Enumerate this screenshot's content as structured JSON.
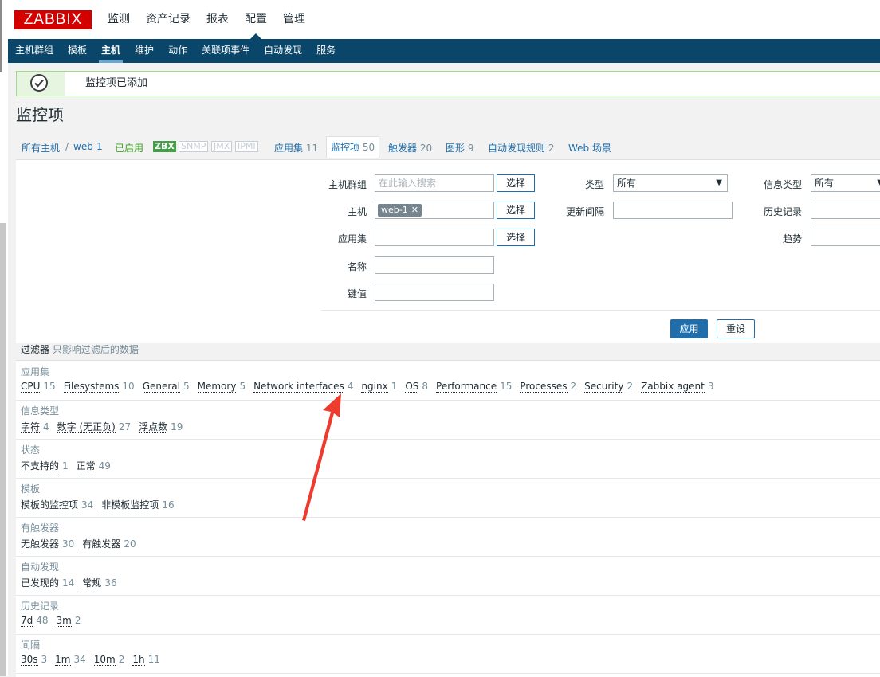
{
  "logo": "ZABBIX",
  "main_menu": [
    "监测",
    "资产记录",
    "报表",
    "配置",
    "管理"
  ],
  "sub_menu": [
    "主机群组",
    "模板",
    "主机",
    "维护",
    "动作",
    "关联项事件",
    "自动发现",
    "服务"
  ],
  "message": "监控项已添加",
  "page_title": "监控项",
  "nav": {
    "all_hosts": "所有主机",
    "sep": "/",
    "host": "web-1",
    "enabled": "已启用",
    "zbx": "ZBX",
    "snmp": "SNMP",
    "jmx": "JMX",
    "ipmi": "IPMI",
    "apps": "应用集",
    "apps_count": "11",
    "items": "监控项",
    "items_count": "50",
    "triggers": "触发器",
    "triggers_count": "20",
    "graphs": "图形",
    "graphs_count": "9",
    "discovery": "自动发现规则",
    "discovery_count": "2",
    "web": "Web 场景"
  },
  "filter": {
    "hostgroup_label": "主机群组",
    "hostgroup_placeholder": "在此输入搜索",
    "host_label": "主机",
    "host_chip": "web-1",
    "app_label": "应用集",
    "name_label": "名称",
    "key_label": "键值",
    "select_btn": "选择",
    "type_label": "类型",
    "type_value": "所有",
    "interval_label": "更新间隔",
    "infotype_label": "信息类型",
    "infotype_value": "所有",
    "history_label": "历史记录",
    "trends_label": "趋势",
    "apply": "应用",
    "reset": "重设"
  },
  "filter_line": {
    "title": "过滤器",
    "hint": "只影响过滤后的数据"
  },
  "subfilters": [
    {
      "title": "应用集",
      "items": [
        {
          "label": "CPU",
          "count": "15"
        },
        {
          "label": "Filesystems",
          "count": "10"
        },
        {
          "label": "General",
          "count": "5"
        },
        {
          "label": "Memory",
          "count": "5"
        },
        {
          "label": "Network interfaces",
          "count": "4"
        },
        {
          "label": "nginx",
          "count": "1"
        },
        {
          "label": "OS",
          "count": "8"
        },
        {
          "label": "Performance",
          "count": "15"
        },
        {
          "label": "Processes",
          "count": "2"
        },
        {
          "label": "Security",
          "count": "2"
        },
        {
          "label": "Zabbix agent",
          "count": "3"
        }
      ]
    },
    {
      "title": "信息类型",
      "items": [
        {
          "label": "字符",
          "count": "4"
        },
        {
          "label": "数字 (无正负)",
          "count": "27"
        },
        {
          "label": "浮点数",
          "count": "19"
        }
      ]
    },
    {
      "title": "状态",
      "items": [
        {
          "label": "不支持的",
          "count": "1"
        },
        {
          "label": "正常",
          "count": "49"
        }
      ]
    },
    {
      "title": "模板",
      "items": [
        {
          "label": "模板的监控项",
          "count": "34"
        },
        {
          "label": "非模板监控项",
          "count": "16"
        }
      ]
    },
    {
      "title": "有触发器",
      "items": [
        {
          "label": "无触发器",
          "count": "30"
        },
        {
          "label": "有触发器",
          "count": "20"
        }
      ]
    },
    {
      "title": "自动发现",
      "items": [
        {
          "label": "已发现的",
          "count": "14"
        },
        {
          "label": "常规",
          "count": "36"
        }
      ]
    },
    {
      "title": "历史记录",
      "items": [
        {
          "label": "7d",
          "count": "48"
        },
        {
          "label": "3m",
          "count": "2"
        }
      ]
    },
    {
      "title": "间隔",
      "items": [
        {
          "label": "30s",
          "count": "3"
        },
        {
          "label": "1m",
          "count": "34"
        },
        {
          "label": "10m",
          "count": "2"
        },
        {
          "label": "1h",
          "count": "11"
        }
      ]
    }
  ],
  "colors": {
    "header_bar": "#0a466a",
    "logo": "#d40000",
    "link": "#1f6eab",
    "annotation_arrow": "#ee3b2f"
  }
}
